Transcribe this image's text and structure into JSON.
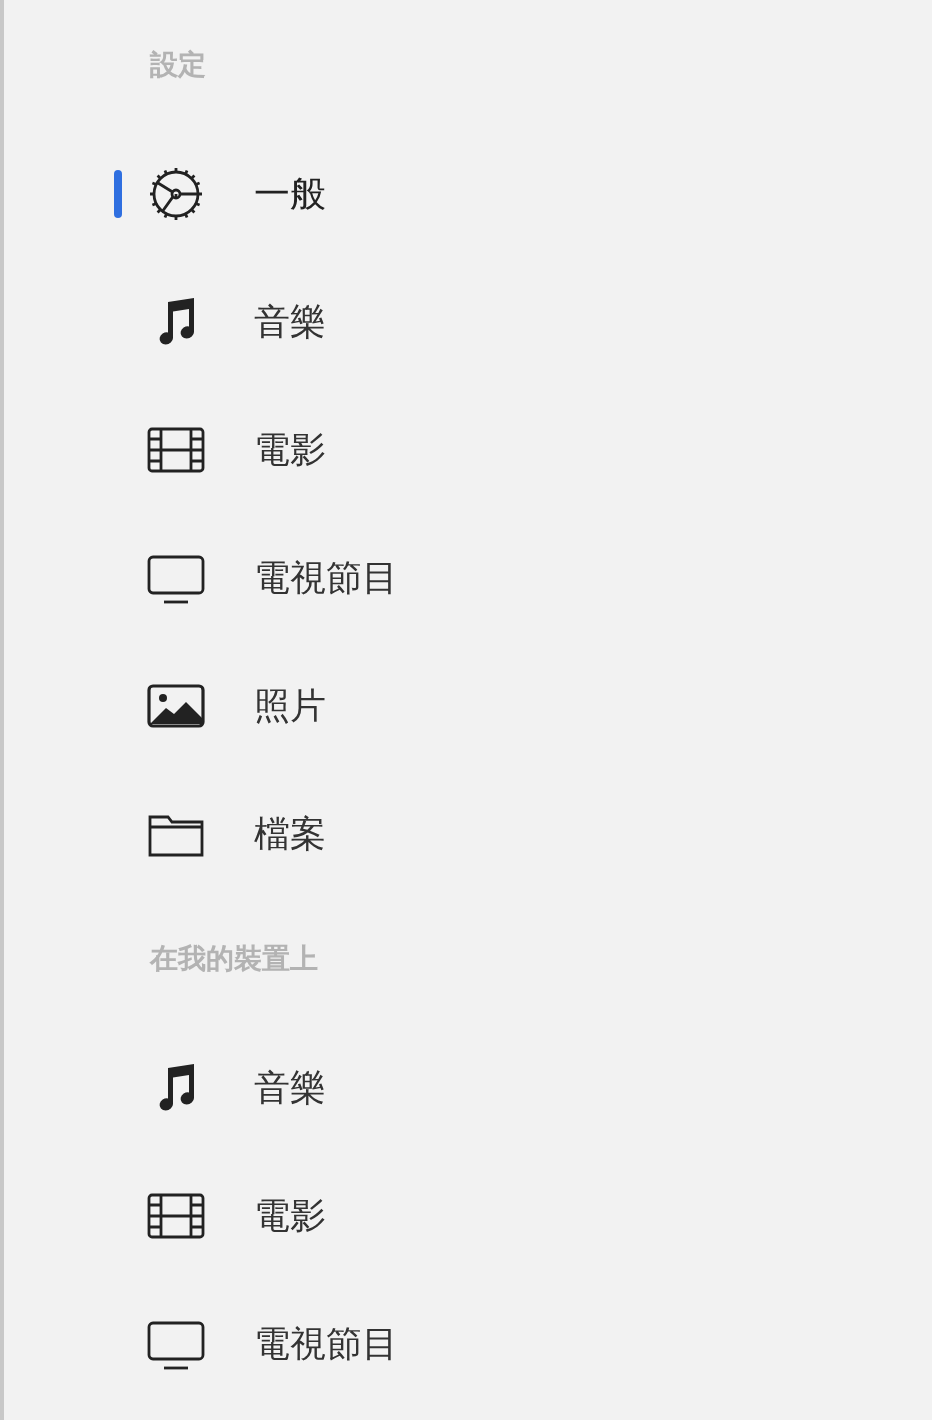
{
  "sections": [
    {
      "title": "設定",
      "items": [
        {
          "kind": "gear",
          "label": "一般",
          "selected": true
        },
        {
          "kind": "music",
          "label": "音樂",
          "selected": false
        },
        {
          "kind": "film",
          "label": "電影",
          "selected": false
        },
        {
          "kind": "tv",
          "label": "電視節目",
          "selected": false
        },
        {
          "kind": "photo",
          "label": "照片",
          "selected": false
        },
        {
          "kind": "folder",
          "label": "檔案",
          "selected": false
        }
      ]
    },
    {
      "title": "在我的裝置上",
      "items": [
        {
          "kind": "music",
          "label": "音樂",
          "selected": false
        },
        {
          "kind": "film",
          "label": "電影",
          "selected": false
        },
        {
          "kind": "tv",
          "label": "電視節目",
          "selected": false
        }
      ]
    }
  ]
}
